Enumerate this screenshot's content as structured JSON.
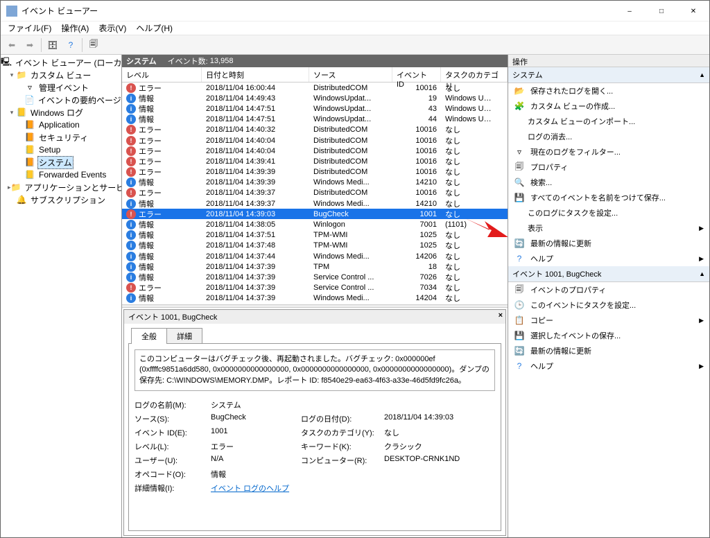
{
  "title": "イベント ビューアー",
  "menu": {
    "file": "ファイル(F)",
    "action": "操作(A)",
    "view": "表示(V)",
    "help": "ヘルプ(H)"
  },
  "tree": {
    "root": "イベント ビューアー (ローカル)",
    "customViews": "カスタム ビュー",
    "adminEvents": "管理イベント",
    "summaryPage": "イベントの要約ページ",
    "winLogs": "Windows ログ",
    "application": "Application",
    "security": "セキュリティ",
    "setup": "Setup",
    "system": "システム",
    "forwarded": "Forwarded Events",
    "appSvcLogs": "アプリケーションとサービス ログ",
    "subscriptions": "サブスクリプション"
  },
  "list": {
    "name": "システム",
    "countLabel": "イベント数:",
    "count": "13,958",
    "columns": {
      "level": "レベル",
      "date": "日付と時刻",
      "source": "ソース",
      "id": "イベント ID",
      "cat": "タスクのカテゴリ"
    },
    "levels": {
      "error": "エラー",
      "info": "情報"
    }
  },
  "events": [
    {
      "lvl": "error",
      "date": "2018/11/04 16:00:44",
      "src": "DistributedCOM",
      "id": "10016",
      "cat": "なし"
    },
    {
      "lvl": "info",
      "date": "2018/11/04 14:49:43",
      "src": "WindowsUpdat...",
      "id": "19",
      "cat": "Windows Updat..."
    },
    {
      "lvl": "info",
      "date": "2018/11/04 14:47:51",
      "src": "WindowsUpdat...",
      "id": "43",
      "cat": "Windows Updat..."
    },
    {
      "lvl": "info",
      "date": "2018/11/04 14:47:51",
      "src": "WindowsUpdat...",
      "id": "44",
      "cat": "Windows Updat..."
    },
    {
      "lvl": "error",
      "date": "2018/11/04 14:40:32",
      "src": "DistributedCOM",
      "id": "10016",
      "cat": "なし"
    },
    {
      "lvl": "error",
      "date": "2018/11/04 14:40:04",
      "src": "DistributedCOM",
      "id": "10016",
      "cat": "なし"
    },
    {
      "lvl": "error",
      "date": "2018/11/04 14:40:04",
      "src": "DistributedCOM",
      "id": "10016",
      "cat": "なし"
    },
    {
      "lvl": "error",
      "date": "2018/11/04 14:39:41",
      "src": "DistributedCOM",
      "id": "10016",
      "cat": "なし"
    },
    {
      "lvl": "error",
      "date": "2018/11/04 14:39:39",
      "src": "DistributedCOM",
      "id": "10016",
      "cat": "なし"
    },
    {
      "lvl": "info",
      "date": "2018/11/04 14:39:39",
      "src": "Windows Medi...",
      "id": "14210",
      "cat": "なし"
    },
    {
      "lvl": "error",
      "date": "2018/11/04 14:39:37",
      "src": "DistributedCOM",
      "id": "10016",
      "cat": "なし"
    },
    {
      "lvl": "info",
      "date": "2018/11/04 14:39:37",
      "src": "Windows Medi...",
      "id": "14210",
      "cat": "なし"
    },
    {
      "lvl": "error",
      "date": "2018/11/04 14:39:03",
      "src": "BugCheck",
      "id": "1001",
      "cat": "なし",
      "sel": true
    },
    {
      "lvl": "info",
      "date": "2018/11/04 14:38:05",
      "src": "Winlogon",
      "id": "7001",
      "cat": "(1101)"
    },
    {
      "lvl": "info",
      "date": "2018/11/04 14:37:51",
      "src": "TPM-WMI",
      "id": "1025",
      "cat": "なし"
    },
    {
      "lvl": "info",
      "date": "2018/11/04 14:37:48",
      "src": "TPM-WMI",
      "id": "1025",
      "cat": "なし"
    },
    {
      "lvl": "info",
      "date": "2018/11/04 14:37:44",
      "src": "Windows Medi...",
      "id": "14206",
      "cat": "なし"
    },
    {
      "lvl": "info",
      "date": "2018/11/04 14:37:39",
      "src": "TPM",
      "id": "18",
      "cat": "なし"
    },
    {
      "lvl": "info",
      "date": "2018/11/04 14:37:39",
      "src": "Service Control ...",
      "id": "7026",
      "cat": "なし"
    },
    {
      "lvl": "error",
      "date": "2018/11/04 14:37:39",
      "src": "Service Control ...",
      "id": "7034",
      "cat": "なし"
    },
    {
      "lvl": "info",
      "date": "2018/11/04 14:37:39",
      "src": "Windows Medi...",
      "id": "14204",
      "cat": "なし"
    }
  ],
  "detail": {
    "title": "イベント 1001, BugCheck",
    "tabGeneral": "全般",
    "tabDetails": "詳細",
    "message": "このコンピューターはバグチェック後、再起動されました。バグチェック: 0x000000ef (0xffffc9851a6dd580, 0x0000000000000000, 0x0000000000000000, 0x0000000000000000)。ダンプの保存先: C:\\WINDOWS\\MEMORY.DMP。レポート ID: f8540e29-ea63-4f63-a33e-46d5fd9fc26a。",
    "labels": {
      "logName": "ログの名前(M):",
      "source": "ソース(S):",
      "eventId": "イベント ID(E):",
      "level": "レベル(L):",
      "user": "ユーザー(U):",
      "opcode": "オペコード(O):",
      "moreInfo": "詳細情報(I):",
      "logged": "ログの日付(D):",
      "taskCat": "タスクのカテゴリ(Y):",
      "keywords": "キーワード(K):",
      "computer": "コンピューター(R):"
    },
    "values": {
      "logName": "システム",
      "source": "BugCheck",
      "eventId": "1001",
      "level": "エラー",
      "user": "N/A",
      "opcode": "情報",
      "logged": "2018/11/04 14:39:03",
      "taskCat": "なし",
      "keywords": "クラシック",
      "computer": "DESKTOP-CRNK1ND",
      "moreInfo": "イベント ログのヘルプ"
    }
  },
  "actions": {
    "title": "操作",
    "sectionEvent": "イベント 1001, BugCheck",
    "sectionSystem": "システム",
    "openSaved": "保存されたログを開く...",
    "createCustom": "カスタム ビューの作成...",
    "importCustom": "カスタム ビューのインポート...",
    "clearLog": "ログの消去...",
    "filterLog": "現在のログをフィルター...",
    "properties": "プロパティ",
    "find": "検索...",
    "saveAll": "すべてのイベントを名前をつけて保存...",
    "attachTask": "このログにタスクを設定...",
    "view": "表示",
    "refresh": "最新の情報に更新",
    "help": "ヘルプ",
    "evProps": "イベントのプロパティ",
    "evAttach": "このイベントにタスクを設定...",
    "copy": "コピー",
    "saveSel": "選択したイベントの保存..."
  }
}
